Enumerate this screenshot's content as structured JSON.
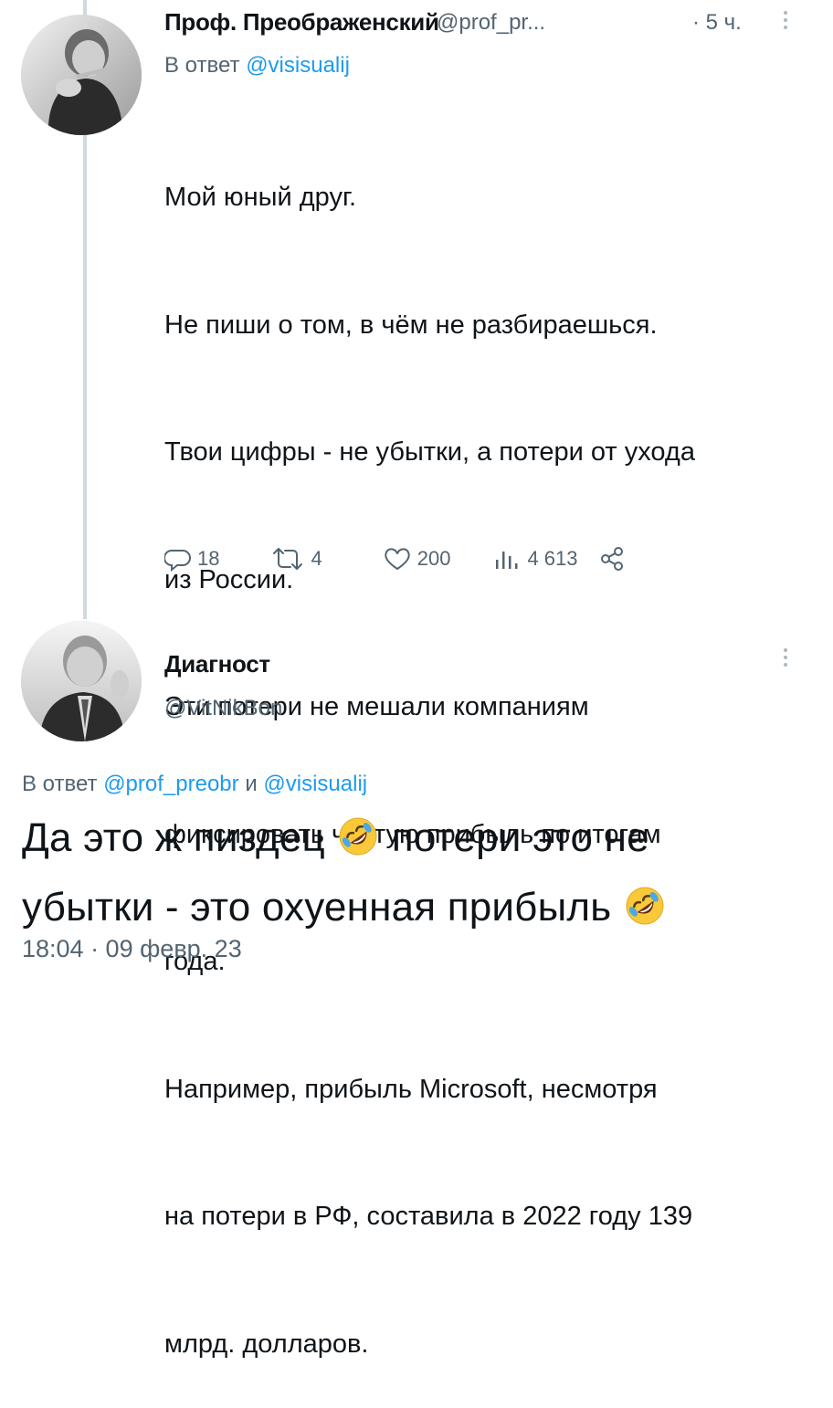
{
  "tweet1": {
    "author_name": "Проф. Преображенский",
    "author_handle": "@prof_pr...",
    "time": "· 5 ч.",
    "reply_prefix": "В ответ",
    "reply_handle": "@visisualij",
    "lines": [
      "Мой юный друг.",
      "Не пиши о том, в чём не разбираешься.",
      "Твои цифры - не убытки, а потери от ухода",
      "из России.",
      "Эти потери не мешали компаниям",
      "фиксировать чистую прибыль по итогам",
      "года.",
      "Например, прибыль Microsoft, несмотря",
      "на потери в РФ, составила в 2022 году 139",
      "млрд. долларов."
    ],
    "actions": {
      "replies": "18",
      "retweets": "4",
      "likes": "200",
      "views": "4 613"
    },
    "icons": [
      "reply-icon",
      "retweet-icon",
      "like-icon",
      "views-icon",
      "share-icon",
      "more-icon"
    ]
  },
  "tweet2": {
    "author_name": "Диагност",
    "author_handle": "@VitNikBon",
    "reply_prefix": "В ответ",
    "reply_handle_1": "@prof_preobr",
    "reply_joiner": "и",
    "reply_handle_2": "@visisualij",
    "line1_a": "Да это ж пиздец",
    "line1_b": "потери это не",
    "line2": "убытки - это охуенная прибыль",
    "emoji": "rolling-on-floor-laughing-emoji",
    "timestamp": "18:04 · 09 февр. 23"
  },
  "colors": {
    "link": "#1d9bf0",
    "secondary_text": "#536471",
    "primary_text": "#0f1419",
    "thread_line": "#cfd9de"
  }
}
